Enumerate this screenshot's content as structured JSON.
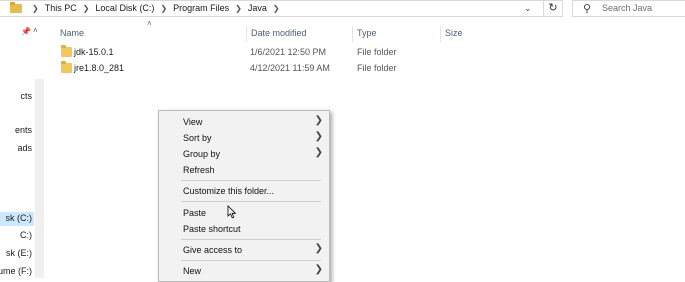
{
  "address": {
    "crumbs": [
      "This PC",
      "Local Disk (C:)",
      "Program Files",
      "Java"
    ],
    "dropdown_icon": "chevron-down-icon",
    "refresh_icon": "refresh-icon"
  },
  "search": {
    "placeholder": "Search Java",
    "icon": "search-icon"
  },
  "nav": {
    "items": [
      {
        "label": "cts"
      },
      {
        "label": "ents"
      },
      {
        "label": "ads"
      },
      {
        "label": "sk (C:)"
      },
      {
        "label": "C:)"
      },
      {
        "label": "sk (E:)"
      },
      {
        "label": "ume (F:)"
      }
    ]
  },
  "columns": {
    "name": "Name",
    "date": "Date modified",
    "type": "Type",
    "size": "Size"
  },
  "files": [
    {
      "name": "jdk-15.0.1",
      "date": "1/6/2021 12:50 PM",
      "type": "File folder",
      "size": ""
    },
    {
      "name": "jre1.8.0_281",
      "date": "4/12/2021 11:59 AM",
      "type": "File folder",
      "size": ""
    }
  ],
  "context_menu": {
    "view": "View",
    "sort_by": "Sort by",
    "group_by": "Group by",
    "refresh": "Refresh",
    "customize": "Customize this folder...",
    "paste": "Paste",
    "paste_shortcut": "Paste shortcut",
    "give_access": "Give access to",
    "new": "New"
  },
  "colors": {
    "selection": "#cce8ff",
    "folder": "#f1c75c",
    "header_text": "#4c607a",
    "menu_bg": "#f2f2f2"
  }
}
